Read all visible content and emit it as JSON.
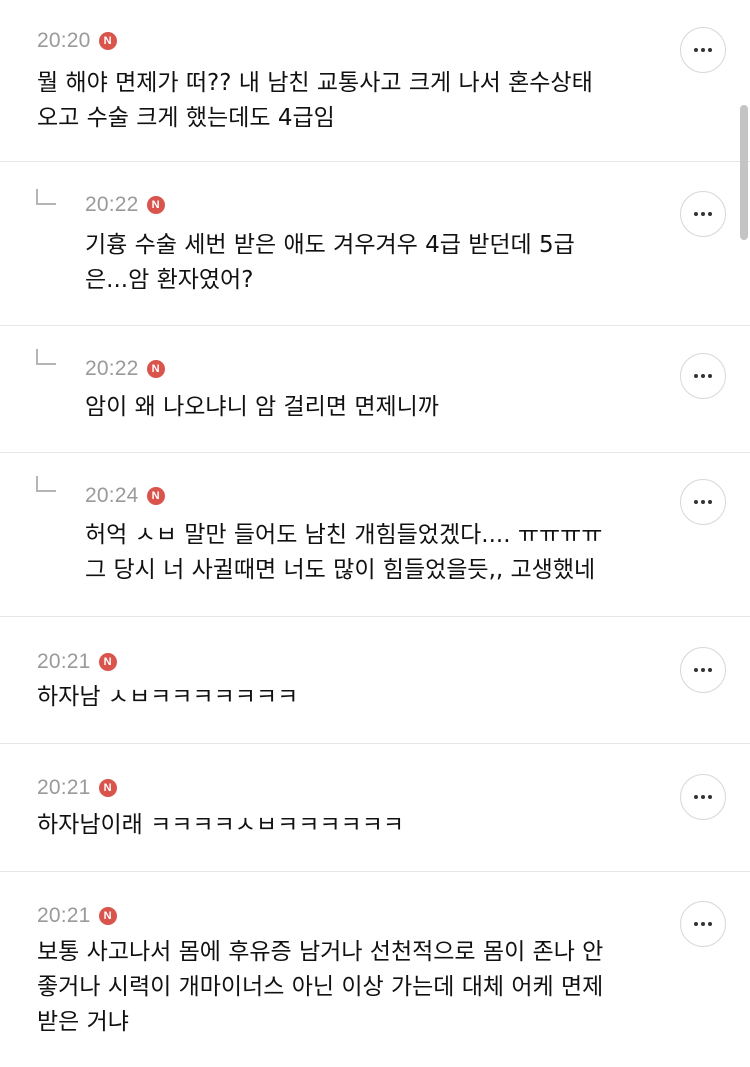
{
  "comments": [
    {
      "time": "20:20",
      "badge": "N",
      "text": "뭘 해야 면제가 떠?? 내 남친 교통사고 크게 나서 혼수상태\n오고 수술 크게 했는데도 4급임",
      "is_reply": false
    },
    {
      "time": "20:22",
      "badge": "N",
      "text": "기흉 수술 세번 받은 애도 겨우겨우 4급 받던데 5급\n은...암 환자였어?",
      "is_reply": true
    },
    {
      "time": "20:22",
      "badge": "N",
      "text": "암이 왜 나오냐니 암 걸리면 면제니까",
      "is_reply": true
    },
    {
      "time": "20:24",
      "badge": "N",
      "text": "허억 ㅅㅂ 말만 들어도 남친 개힘들었겠다.... ㅠㅠㅠㅠ\n그 당시 너 사귈때면 너도 많이 힘들었을듯,, 고생했네",
      "is_reply": true
    },
    {
      "time": "20:21",
      "badge": "N",
      "text": "하자남 ㅅㅂㅋㅋㅋㅋㅋㅋㅋ",
      "is_reply": false
    },
    {
      "time": "20:21",
      "badge": "N",
      "text": "하자남이래 ㅋㅋㅋㅋㅅㅂㅋㅋㅋㅋㅋㅋ",
      "is_reply": false
    },
    {
      "time": "20:21",
      "badge": "N",
      "text": "보통 사고나서 몸에 후유증 남거나 선천적으로 몸이 존나 안\n좋거나 시력이 개마이너스 아닌 이상 가는데 대체 어케 면제\n받은 거냐",
      "is_reply": false
    }
  ],
  "colors": {
    "badge": "#d9544d",
    "time": "#9a9a9a",
    "divider": "#e6e6e6"
  },
  "icons": {
    "more": "more-horizontal-icon",
    "reply": "reply-corner-icon"
  }
}
